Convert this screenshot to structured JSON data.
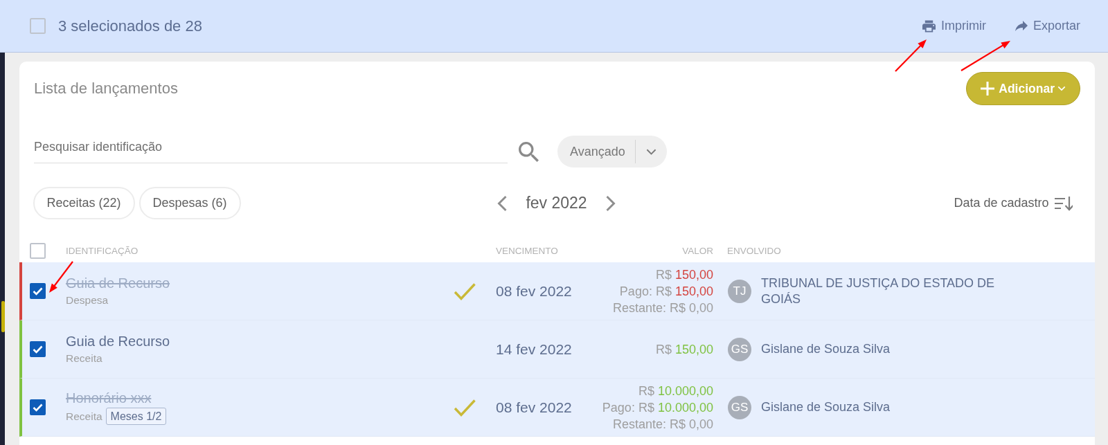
{
  "selection_bar": {
    "select_all_checked": false,
    "summary": "3 selecionados de 28",
    "actions": [
      {
        "kind": "print",
        "label": "Imprimir"
      },
      {
        "kind": "export",
        "label": "Exportar"
      }
    ]
  },
  "panel": {
    "title": "Lista de lançamentos",
    "add_button": "Adicionar"
  },
  "search": {
    "placeholder": "Pesquisar identificação",
    "advanced_button": "Avançado"
  },
  "filters": [
    {
      "label": "Receitas (22)",
      "selected": false
    },
    {
      "label": "Despesas (6)",
      "selected": false
    }
  ],
  "period": {
    "label": "fev 2022"
  },
  "sort": {
    "label": "Data de cadastro"
  },
  "table": {
    "header_checked": false,
    "columns": [
      "IDENTIFICAÇÃO",
      "VENCIMENTO",
      "VALOR",
      "ENVOLVIDO"
    ],
    "rows": [
      {
        "checked": true,
        "color": "#d4443f",
        "paid": true,
        "title": "Guia de Recurso",
        "type": "Despesa",
        "due": "08 fev 2022",
        "value_lines": [
          {
            "label": "R$",
            "amount": "150,00"
          },
          {
            "label": "Pago: R$",
            "amount": "150,00"
          },
          {
            "label": "Restante: R$ 0,00"
          }
        ],
        "person": {
          "initials": "TJ",
          "name": "TRIBUNAL DE JUSTIÇA DO ESTADO DE GOIÁS"
        }
      },
      {
        "checked": true,
        "color": "#7fc241",
        "paid": false,
        "title": "Guia de Recurso",
        "type": "Receita",
        "due": "14 fev 2022",
        "value_lines": [
          {
            "label": "R$",
            "amount": "150,00"
          }
        ],
        "person": {
          "initials": "GS",
          "name": "Gislane de Souza Silva"
        }
      },
      {
        "checked": true,
        "color": "#7fc241",
        "paid": true,
        "title": "Honorário xxx",
        "type": "Receita",
        "tag": "Meses 1/2",
        "due": "08 fev 2022",
        "value_lines": [
          {
            "label": "R$",
            "amount": "10.000,00"
          },
          {
            "label": "Pago: R$",
            "amount": "10.000,00"
          },
          {
            "label": "Restante: R$ 0,00"
          }
        ],
        "person": {
          "initials": "GS",
          "name": "Gislane de Souza Silva"
        }
      }
    ]
  }
}
